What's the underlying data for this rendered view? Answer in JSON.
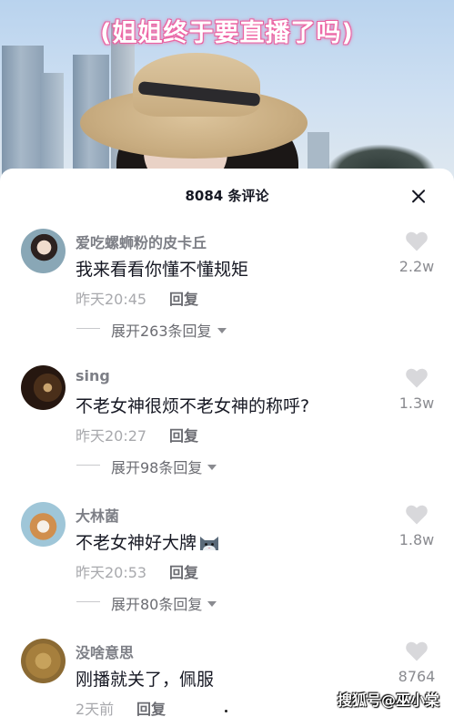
{
  "video": {
    "caption": "(姐姐终于要直播了吗)"
  },
  "sheet": {
    "title": "8084 条评论"
  },
  "comments": [
    {
      "username": "爱吃螺蛳粉的皮卡丘",
      "text": "我来看看你懂不懂规矩",
      "time": "昨天20:45",
      "reply_label": "回复",
      "expand_label": "展开263条回复",
      "likes": "2.2w"
    },
    {
      "username": "sing",
      "text": "不老女神很烦不老女神的称呼?",
      "time": "昨天20:27",
      "reply_label": "回复",
      "expand_label": "展开98条回复",
      "likes": "1.3w"
    },
    {
      "username": "大林菌",
      "text": "不老女神好大牌",
      "emoji": "cat-emoji",
      "time": "昨天20:53",
      "reply_label": "回复",
      "expand_label": "展开80条回复",
      "likes": "1.8w"
    },
    {
      "username": "没啥意思",
      "text": "刚播就关了，佩服",
      "time": "2天前",
      "reply_label": "回复",
      "likes": "8764"
    }
  ],
  "watermark": "搜狐号@巫小棠",
  "icons": {
    "close": "close-icon",
    "like": "heart-icon",
    "expand": "caret-down-icon"
  },
  "colors": {
    "caption_glow": "#f06aa8",
    "heart": "#d8d8db",
    "text_primary": "#161823",
    "text_secondary": "#a8a9ad"
  }
}
